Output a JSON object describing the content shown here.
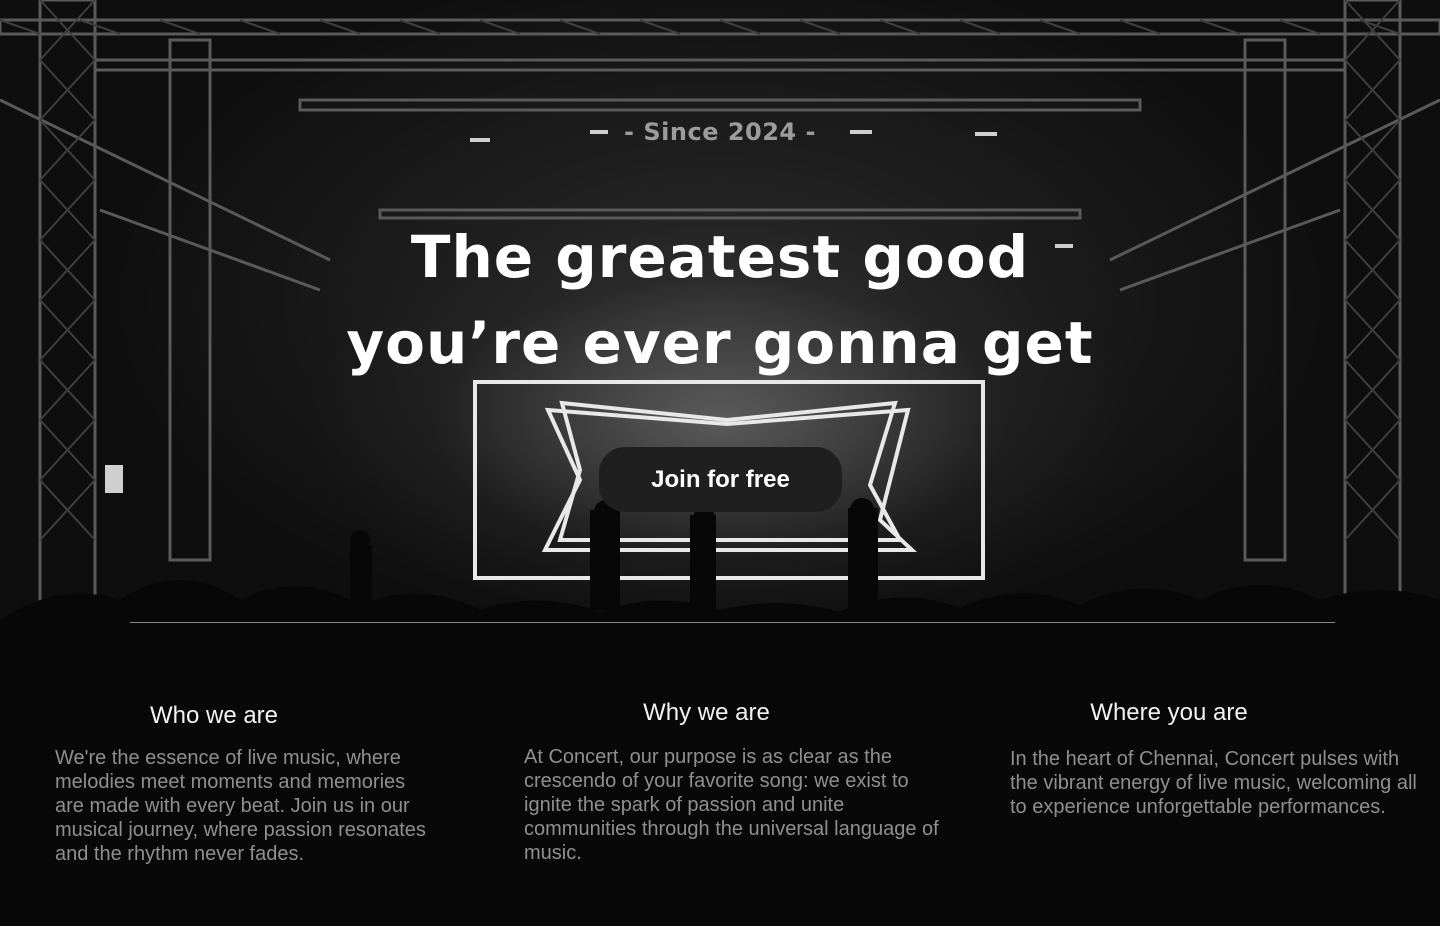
{
  "hero": {
    "since_label": "- Since 2024 -",
    "headline_line1": "The greatest good",
    "headline_line2": "you’re ever gonna get",
    "cta_label": "Join for free"
  },
  "sections": [
    {
      "title": "Who we are",
      "body": "We're the essence of live music, where melodies meet moments and  memories are made with every beat. Join us in our musical journey, where  passion resonates and the rhythm never fades."
    },
    {
      "title": "Why we are",
      "body": "At Concert, our purpose is as clear as the crescendo of  your favorite song: we exist to ignite the spark of passion and unite communities through the universal language of music."
    },
    {
      "title": "Where you are",
      "body": "In the heart of Chennai, Concert pulses with the  vibrant energy of live music, welcoming all to experience unforgettable performances."
    }
  ]
}
